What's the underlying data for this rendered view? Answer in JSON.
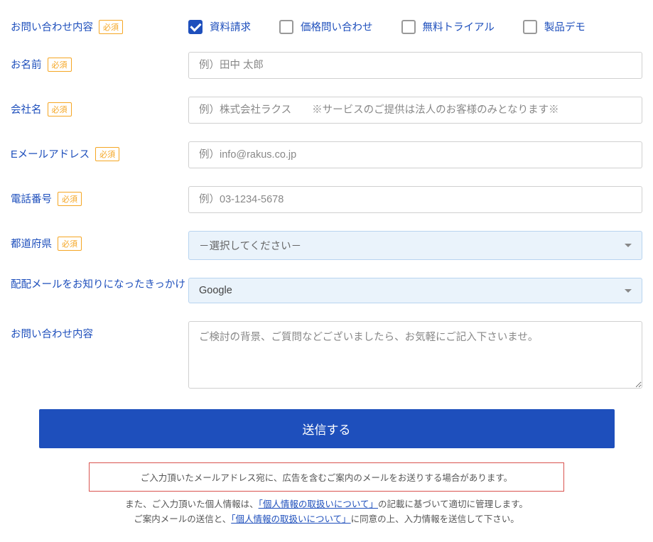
{
  "labels": {
    "inquiry_type": "お問い合わせ内容",
    "name": "お名前",
    "company": "会社名",
    "email": "Eメールアドレス",
    "phone": "電話番号",
    "prefecture": "都道府県",
    "referral": "配配メールをお知りになったきっかけ",
    "inquiry_content": "お問い合わせ内容",
    "required": "必須"
  },
  "checkboxes": {
    "doc_request": "資料請求",
    "price_inquiry": "価格問い合わせ",
    "free_trial": "無料トライアル",
    "product_demo": "製品デモ"
  },
  "placeholders": {
    "name": "例）田中 太郎",
    "company": "例）株式会社ラクス　　※サービスのご提供は法人のお客様のみとなります※",
    "email": "例）info@rakus.co.jp",
    "phone": "例）03-1234-5678",
    "inquiry_content": "ご検討の背景、ご質問などございましたら、お気軽にご記入下さいませ。"
  },
  "selects": {
    "prefecture_placeholder": "－選択してください－",
    "referral_value": "Google"
  },
  "submit_label": "送信する",
  "notices": {
    "box": "ご入力頂いたメールアドレス宛に、広告を含むご案内のメールをお送りする場合があります。",
    "line1_pre": "また、ご入力頂いた個人情報は、",
    "line1_link": "「個人情報の取扱いについて」",
    "line1_post": "の記載に基づいて適切に管理します。",
    "line2_pre": "ご案内メールの送信と、",
    "line2_link": "「個人情報の取扱いについて」",
    "line2_post": "に同意の上、入力情報を送信して下さい。"
  }
}
